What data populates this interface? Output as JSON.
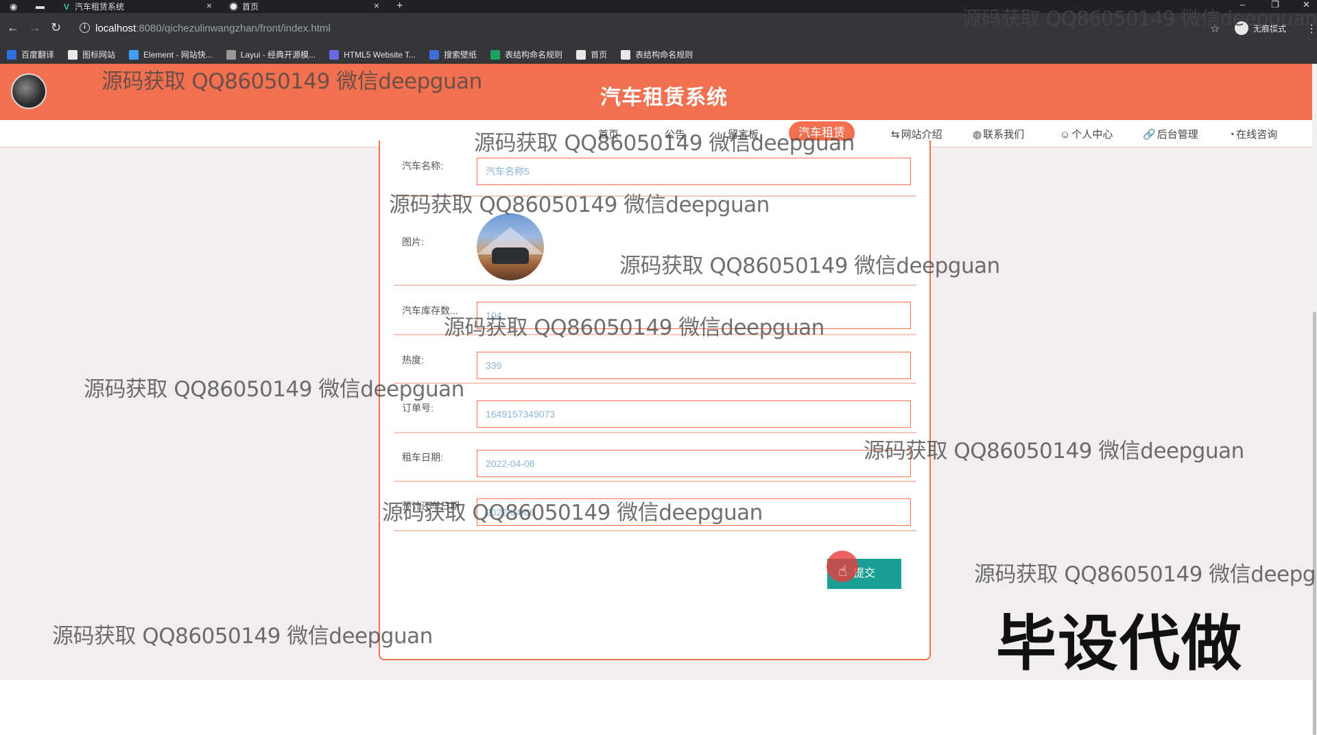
{
  "browser": {
    "tabs": [
      {
        "title": "汽车租赁系统"
      },
      {
        "title": "首页"
      }
    ],
    "new_tab": "+",
    "url_host": "localhost",
    "url_path": ":8080/qichezulinwangzhan/front/index.html",
    "profile_label": "无痕模式",
    "bookmarks": [
      {
        "label": "百度翻译",
        "color": "#2f6fe0"
      },
      {
        "label": "图标网站",
        "color": "#e8e8e8"
      },
      {
        "label": "Element - 网站快...",
        "color": "#409eff"
      },
      {
        "label": "Layui - 经典开源模...",
        "color": "#999999"
      },
      {
        "label": "HTML5 Website T...",
        "color": "#6b6be0"
      },
      {
        "label": "搜索壁纸",
        "color": "#3d6fd6"
      },
      {
        "label": "表结构命名规则",
        "color": "#1aa260"
      },
      {
        "label": "首页",
        "color": "#e8e8e8"
      },
      {
        "label": "表结构命名规则",
        "color": "#e8e8e8"
      }
    ]
  },
  "site": {
    "title": "汽车租赁系统",
    "nav": [
      {
        "label": "首页"
      },
      {
        "label": "公告"
      },
      {
        "label": "留言板"
      },
      {
        "label": "汽车租赁"
      },
      {
        "label": "网站介绍"
      },
      {
        "label": "联系我们"
      },
      {
        "label": "个人中心"
      },
      {
        "label": "后台管理"
      },
      {
        "label": "在线咨询"
      }
    ],
    "nav_icons": {
      "4": "⇆",
      "5": "◍",
      "6": "☺",
      "7": "🔗",
      "8": "◔"
    },
    "active_nav": "汽车租赁",
    "accent_color": "#f1704f",
    "button_color": "#1aa094"
  },
  "form": {
    "fields": [
      {
        "label": "汽车名称:",
        "value": "汽车名称5"
      },
      {
        "label": "图片:",
        "value": ""
      },
      {
        "label": "汽车库存数...",
        "value": "104"
      },
      {
        "label": "热度:",
        "value": "339"
      },
      {
        "label": "订单号:",
        "value": "1649157349073"
      },
      {
        "label": "租车日期:",
        "value": "2022-04-06"
      },
      {
        "label": "预计还车日期",
        "value": "2022-04-08"
      }
    ],
    "submit_label": "提交"
  },
  "watermark": {
    "text": "源码获取 QQ86050149 微信deepguan",
    "promo": "毕设代做"
  }
}
